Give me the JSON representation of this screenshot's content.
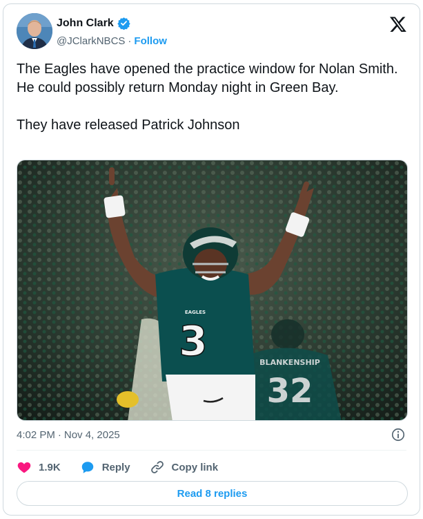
{
  "author": {
    "name": "John Clark",
    "handle": "@JClarkNBCS",
    "separator": "·",
    "follow_label": "Follow",
    "verified": true
  },
  "tweet": {
    "text": "The Eagles have opened the practice window for Nolan Smith. He could possibly return Monday night in Green Bay.\n\nThey have released Patrick Johnson",
    "time": "4:02 PM",
    "date_separator": "·",
    "date": "Nov 4, 2025"
  },
  "photo": {
    "jersey_number": "3",
    "background_jersey_number": "32",
    "jersey_text": "EAGLES",
    "background_name_text": "BLANKENSHIP"
  },
  "actions": {
    "likes_count": "1.9K",
    "reply_label": "Reply",
    "copy_link_label": "Copy link"
  },
  "read_replies_label": "Read 8 replies",
  "colors": {
    "accent": "#1d9bf0",
    "like": "#f91880",
    "muted_text": "#536471",
    "eagles_green": "#0b4f4f"
  },
  "icons": [
    "verified-badge-icon",
    "x-logo-icon",
    "info-icon",
    "heart-icon",
    "reply-bubble-icon",
    "link-icon"
  ]
}
